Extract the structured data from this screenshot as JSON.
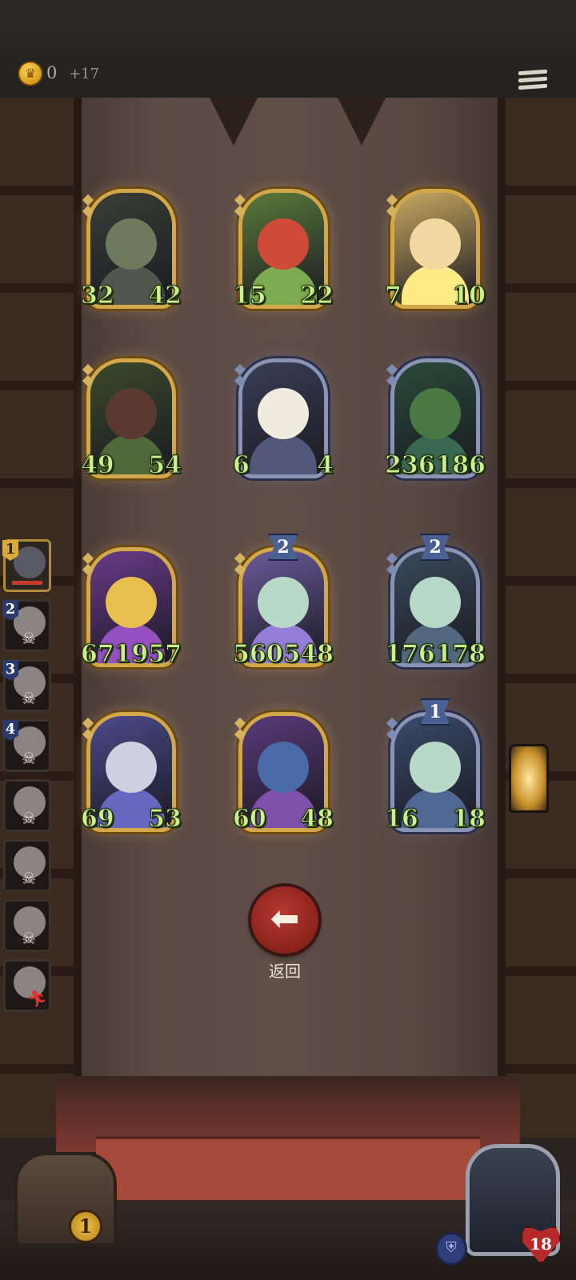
{
  "hud": {
    "gold": "0",
    "gold_income": "+17"
  },
  "board": {
    "cards": [
      {
        "attack": "32",
        "health": "42",
        "tier": "",
        "frame": "gold"
      },
      {
        "attack": "15",
        "health": "22",
        "tier": "",
        "frame": "gold"
      },
      {
        "attack": "7",
        "health": "10",
        "tier": "",
        "frame": "gold"
      },
      {
        "attack": "49",
        "health": "54",
        "tier": "",
        "frame": "gold"
      },
      {
        "attack": "6",
        "health": "4",
        "tier": "",
        "frame": "blue"
      },
      {
        "attack": "236",
        "health": "186",
        "tier": "",
        "frame": "blue"
      },
      {
        "attack": "671",
        "health": "957",
        "tier": "",
        "frame": "gold"
      },
      {
        "attack": "560",
        "health": "548",
        "tier": "2",
        "frame": "gold"
      },
      {
        "attack": "176",
        "health": "178",
        "tier": "2",
        "frame": "blue"
      },
      {
        "attack": "69",
        "health": "53",
        "tier": "",
        "frame": "gold"
      },
      {
        "attack": "60",
        "health": "48",
        "tier": "",
        "frame": "gold"
      },
      {
        "attack": "16",
        "health": "18",
        "tier": "1",
        "frame": "blue"
      }
    ]
  },
  "roster": [
    {
      "rank": "1",
      "state": "active"
    },
    {
      "rank": "2",
      "state": "dead"
    },
    {
      "rank": "3",
      "state": "dead"
    },
    {
      "rank": "4",
      "state": "dead"
    },
    {
      "rank": "",
      "state": "dead"
    },
    {
      "rank": "",
      "state": "dead"
    },
    {
      "rank": "",
      "state": "dead"
    },
    {
      "rank": "",
      "state": "fled"
    }
  ],
  "actions": {
    "back_label": "返回"
  },
  "footer": {
    "chest_count": "1",
    "hero_health": "18"
  },
  "colors": {
    "stat_text": "#c9f08a",
    "gold_frame": "#d3a84a",
    "blue_frame": "#8a94b4",
    "back_button": "#a02c24"
  },
  "icons": {
    "gold": "crown-coin-icon",
    "menu": "hamburger-menu-icon",
    "back": "arrow-left-icon",
    "skull": "skull-icon",
    "fled": "running-man-icon",
    "chest": "treasure-chest-icon",
    "shield": "shield-icon",
    "heart": "heart-icon"
  }
}
